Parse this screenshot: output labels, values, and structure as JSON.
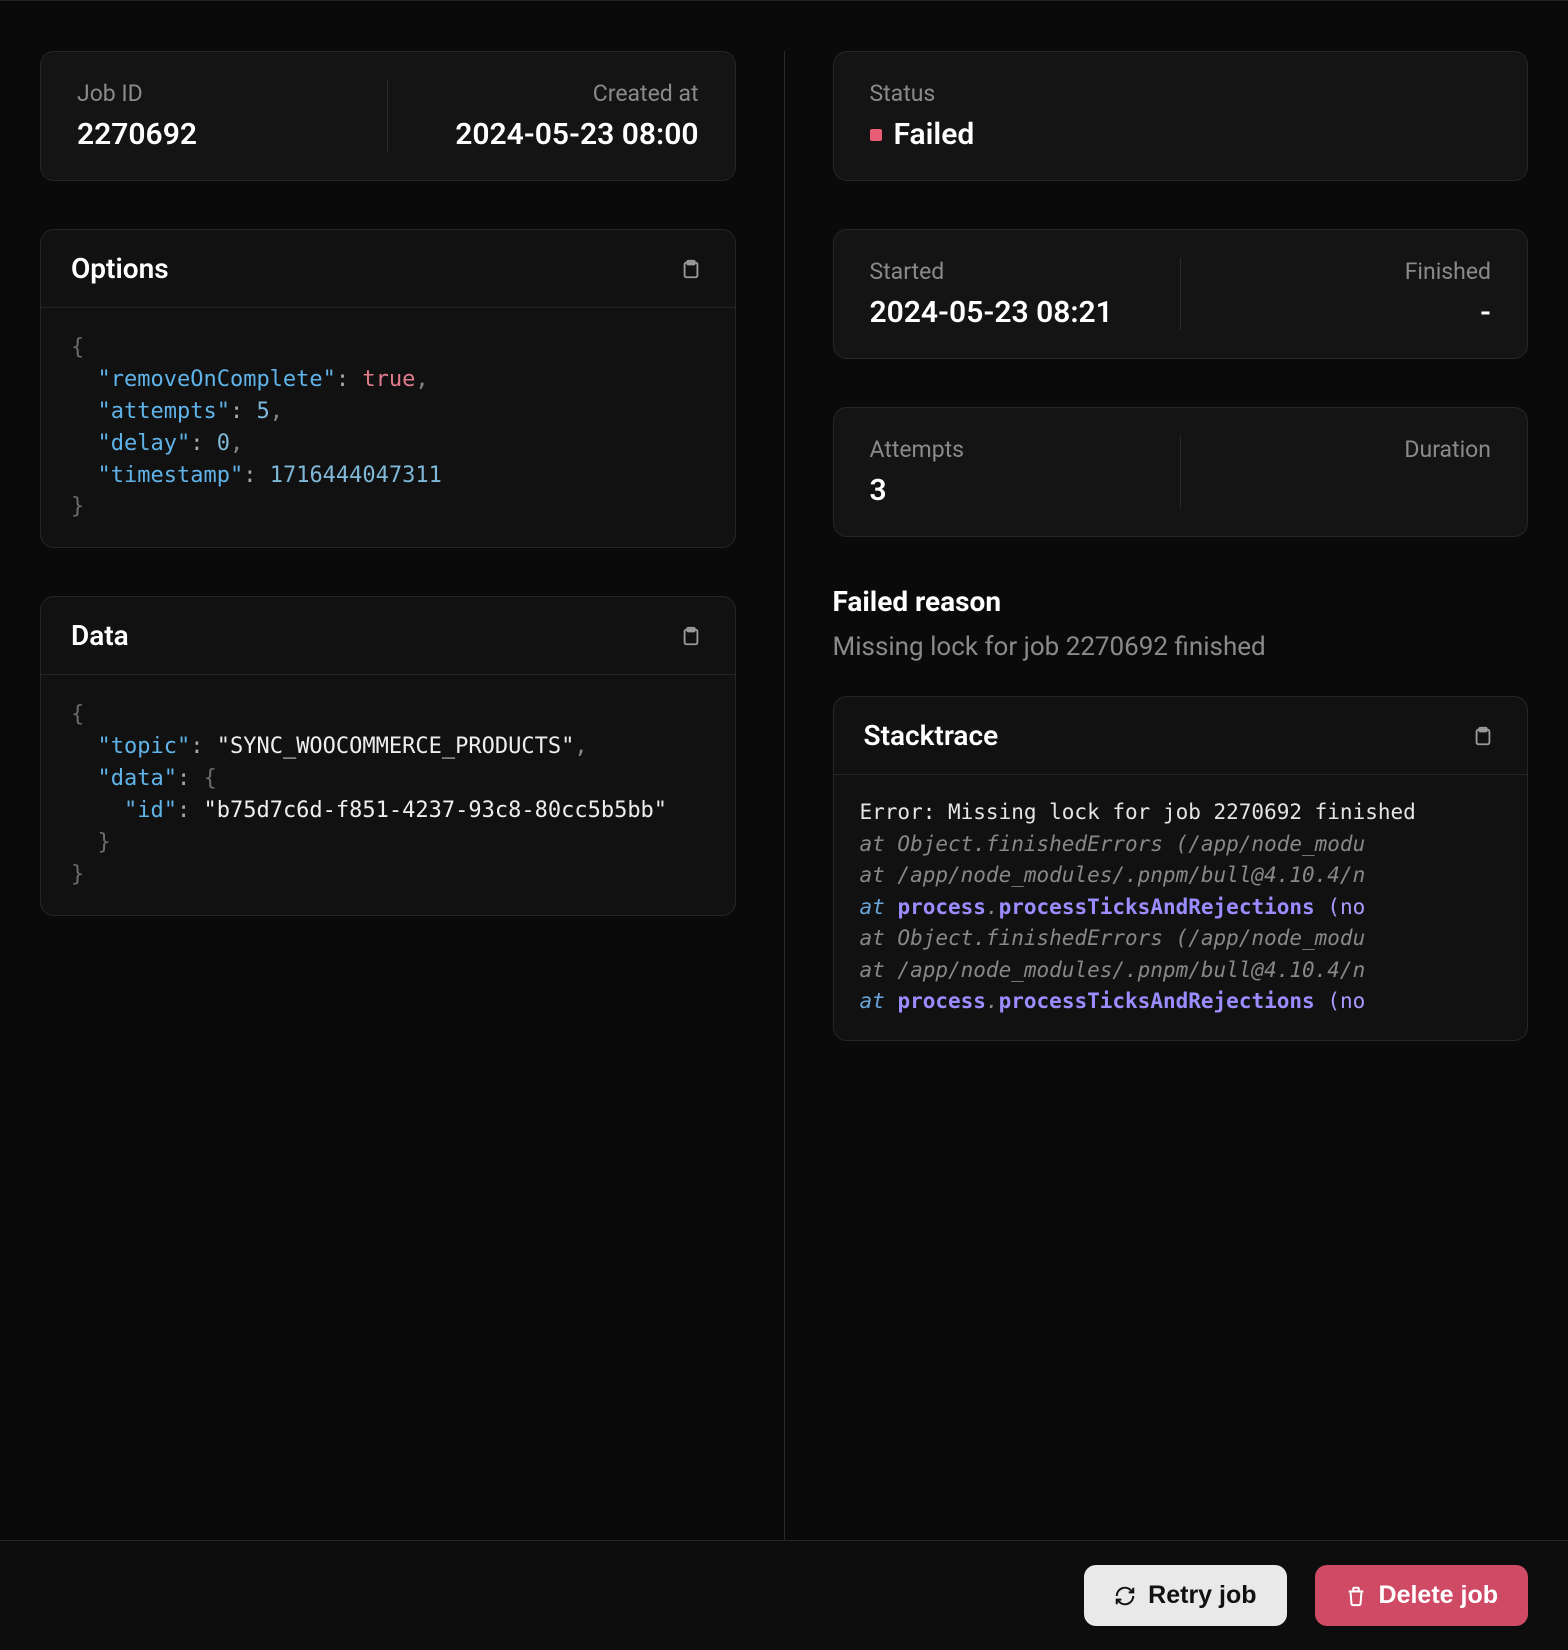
{
  "left": {
    "job_id_label": "Job ID",
    "job_id": "2270692",
    "created_label": "Created at",
    "created": "2024-05-23 08:00",
    "options_title": "Options",
    "options": {
      "removeOnComplete": true,
      "attempts": 5,
      "delay": 0,
      "timestamp": 1716444047311
    },
    "data_title": "Data",
    "data": {
      "topic": "SYNC_WOOCOMMERCE_PRODUCTS",
      "data": {
        "id": "b75d7c6d-f851-4237-93c8-80cc5b5bb"
      }
    }
  },
  "right": {
    "status_label": "Status",
    "status": "Failed",
    "started_label": "Started",
    "started": "2024-05-23 08:21",
    "finished_label": "Finished",
    "finished": "-",
    "attempts_label": "Attempts",
    "attempts": "3",
    "duration_label": "Duration",
    "duration": "",
    "failed_title": "Failed reason",
    "failed_reason": "Missing lock for job 2270692 finished",
    "stack_title": "Stacktrace",
    "stack": {
      "error": "Error: Missing lock for job 2270692 finished",
      "lines": [
        {
          "type": "plain",
          "pad": "    ",
          "text": "at Object.finishedErrors (/app/node_modu"
        },
        {
          "type": "plain",
          "pad": "    ",
          "text": "at /app/node_modules/.pnpm/bull@4.10.4/n"
        },
        {
          "type": "bold",
          "pad": "    ",
          "at": "at ",
          "obj": "process",
          "dot": ".",
          "fn": "processTicksAndRejections",
          "tail": " (no"
        },
        {
          "type": "plain",
          "pad": "    ",
          "text": "at Object.finishedErrors (/app/node_modu"
        },
        {
          "type": "plain",
          "pad": "    ",
          "text": "at /app/node_modules/.pnpm/bull@4.10.4/n"
        },
        {
          "type": "bold",
          "pad": "    ",
          "at": "at ",
          "obj": "process",
          "dot": ".",
          "fn": "processTicksAndRejections",
          "tail": " (no"
        }
      ]
    }
  },
  "footer": {
    "retry": "Retry job",
    "delete": "Delete job"
  }
}
